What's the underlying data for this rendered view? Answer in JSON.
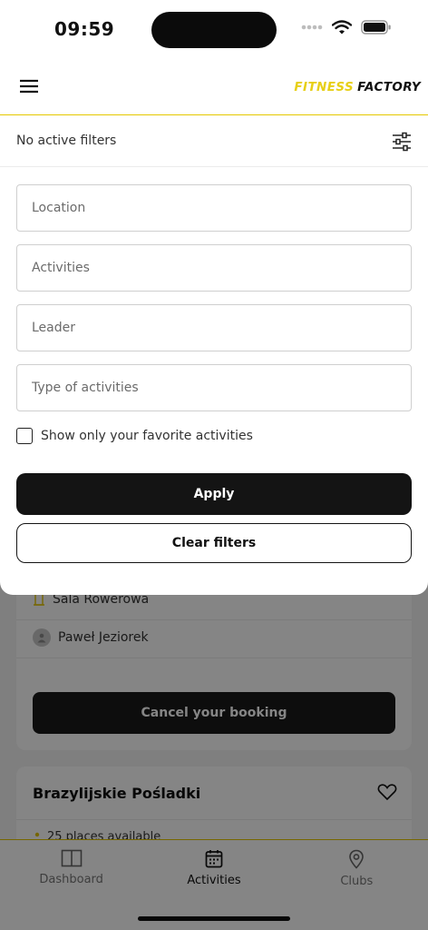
{
  "status_bar": {
    "time": "09:59"
  },
  "header": {
    "logo_part1": "FITNESS",
    "logo_part2": "FACTORY",
    "menu_icon": "hamburger-menu-icon"
  },
  "filters": {
    "status_text": "No active filters",
    "toggle_icon": "sliders-icon",
    "location_placeholder": "Location",
    "activities_placeholder": "Activities",
    "leader_placeholder": "Leader",
    "type_placeholder": "Type of activities",
    "favorites_label": "Show only your favorite activities",
    "favorites_checked": false,
    "apply_label": "Apply",
    "clear_label": "Clear filters"
  },
  "background": {
    "booking_card": {
      "room": "Sala Rowerowa",
      "leader": "Paweł Jeziorek",
      "cancel_label": "Cancel your booking"
    },
    "next_card": {
      "title": "Brazylijskie Pośladki",
      "places": "25 places available"
    }
  },
  "bottom_nav": {
    "items": [
      {
        "label": "Dashboard",
        "icon": "dashboard-icon"
      },
      {
        "label": "Activities",
        "icon": "calendar-icon",
        "active": true
      },
      {
        "label": "Clubs",
        "icon": "location-pin-icon"
      }
    ]
  },
  "colors": {
    "brand_yellow": "#e7cf16",
    "primary_dark": "#141414"
  }
}
